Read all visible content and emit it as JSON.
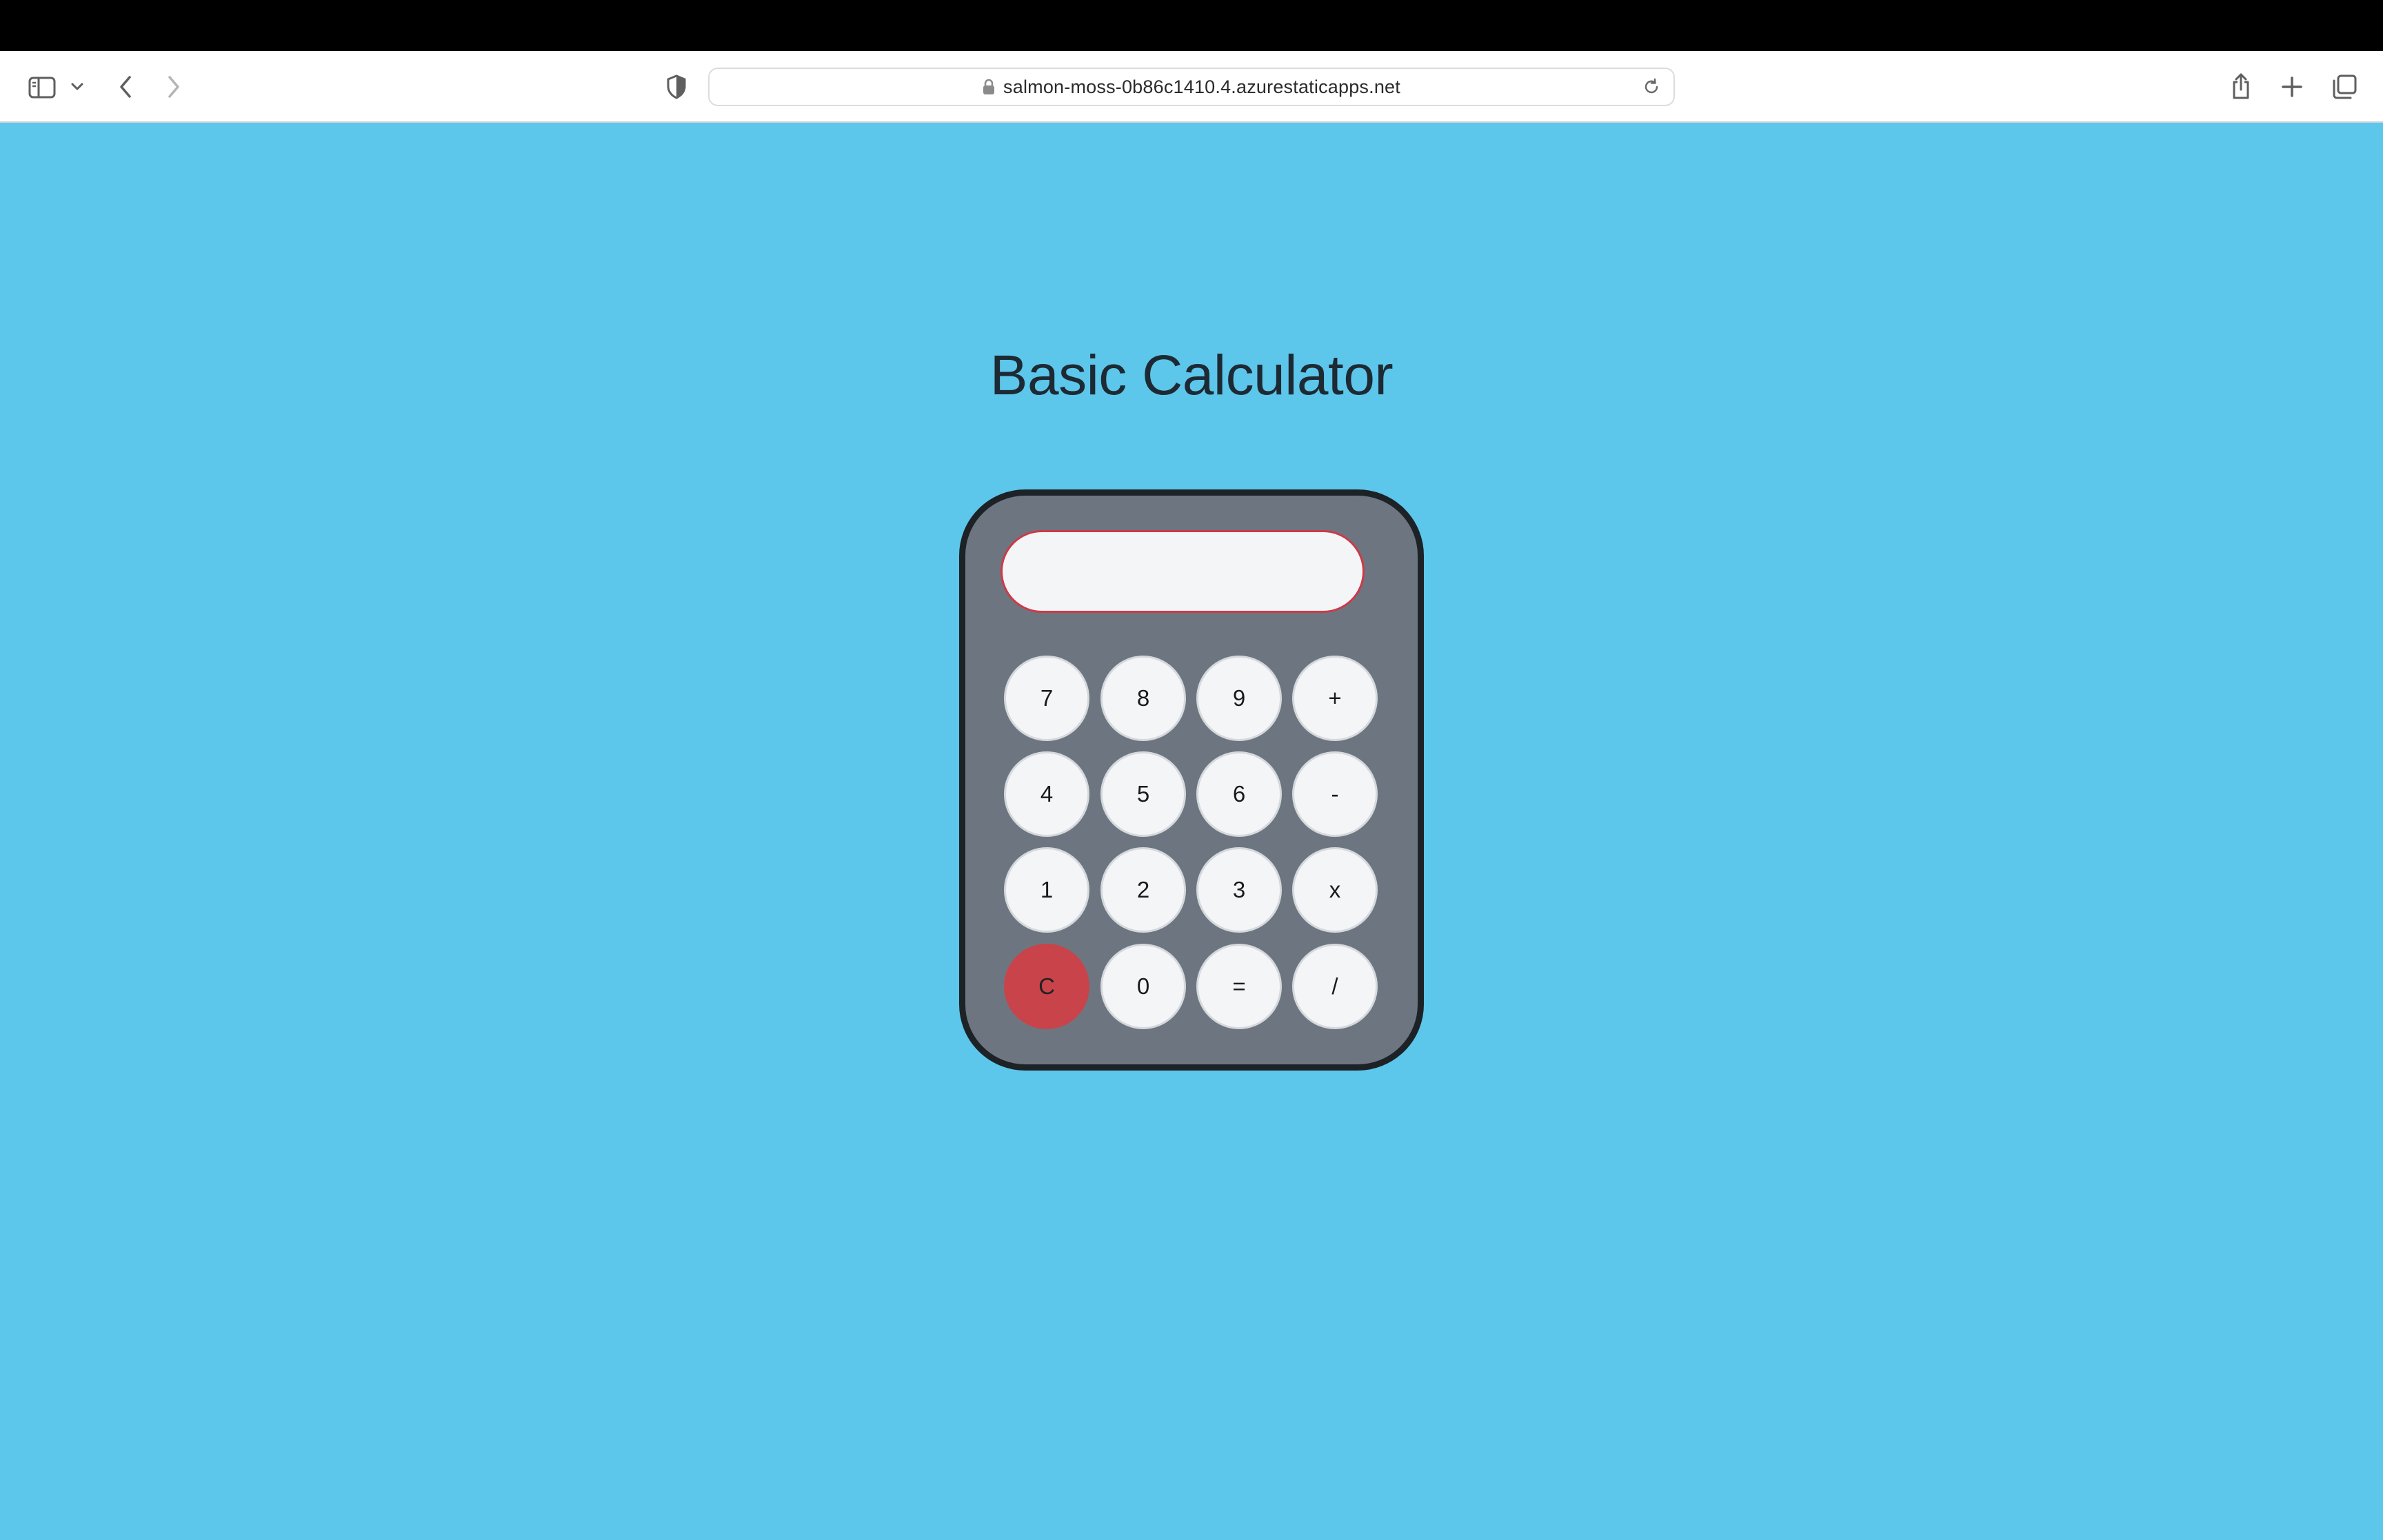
{
  "browser": {
    "url": "salmon-moss-0b86c1410.4.azurestaticapps.net",
    "icons": {
      "sidebar": "sidebar-icon",
      "sidebar_menu": "chevron-down-icon",
      "back": "chevron-left-icon",
      "forward": "chevron-right-icon",
      "privacy": "shield-icon",
      "lock": "lock-icon",
      "reload": "reload-icon",
      "share": "share-icon",
      "new_tab": "plus-icon",
      "tabs_overview": "tabs-icon"
    }
  },
  "page": {
    "title": "Basic Calculator",
    "background": "#5dc6eb"
  },
  "calculator": {
    "display_value": "",
    "body_color": "#6d7680",
    "clear_color": "#c9434b",
    "keys": [
      [
        "7",
        "8",
        "9",
        "+"
      ],
      [
        "4",
        "5",
        "6",
        "-"
      ],
      [
        "1",
        "2",
        "3",
        "x"
      ],
      [
        "C",
        "0",
        "=",
        "/"
      ]
    ]
  }
}
